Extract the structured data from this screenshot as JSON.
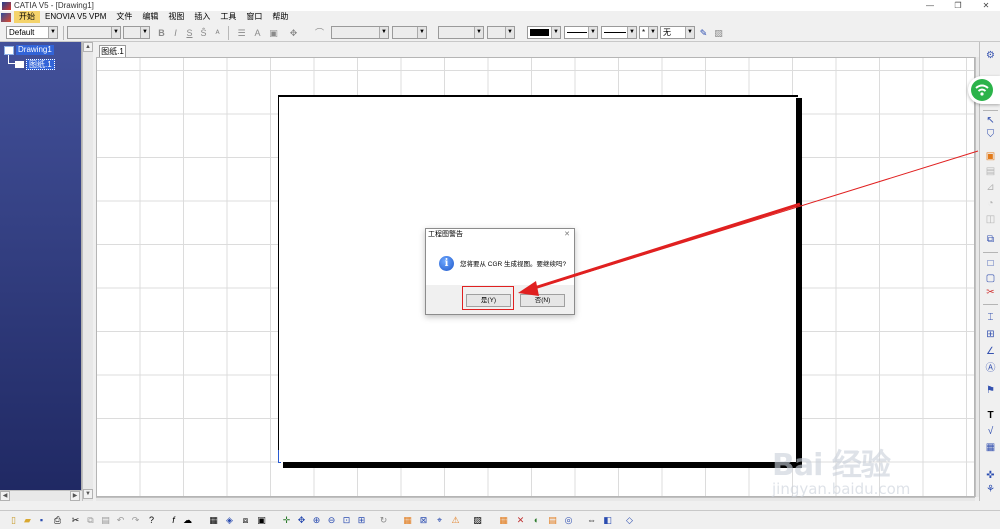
{
  "window": {
    "title": "CATIA V5 - [Drawing1]",
    "minimize_glyph": "—",
    "restore_glyph": "❐",
    "close_glyph": "✕"
  },
  "menu": {
    "items": [
      "开始",
      "ENOVIA V5 VPM",
      "文件",
      "编辑",
      "视图",
      "插入",
      "工具",
      "窗口",
      "帮助"
    ]
  },
  "toolbar": {
    "style_value": "Default",
    "line_fill_value": "无",
    "point_value": "*"
  },
  "tree": {
    "root_label": "Drawing1",
    "child_label": "图纸.1"
  },
  "sheet_tab": {
    "label": "图纸.1"
  },
  "dialog": {
    "title": "工程图警告",
    "close_glyph": "✕",
    "message": "您将要从 CGR 生成视图。要继续吗?",
    "info_glyph": "i",
    "yes_label": "是(Y)",
    "no_label": "否(N)"
  },
  "watermark": {
    "brand": "Bai 经验",
    "url": "jingyan.baidu.com"
  },
  "colors": {
    "tree_bg_top": "#43519a",
    "tree_bg_bottom": "#1f2862",
    "selection": "#3264d8",
    "annotation_red": "#e02020",
    "menu_active": "#f4d36b"
  }
}
